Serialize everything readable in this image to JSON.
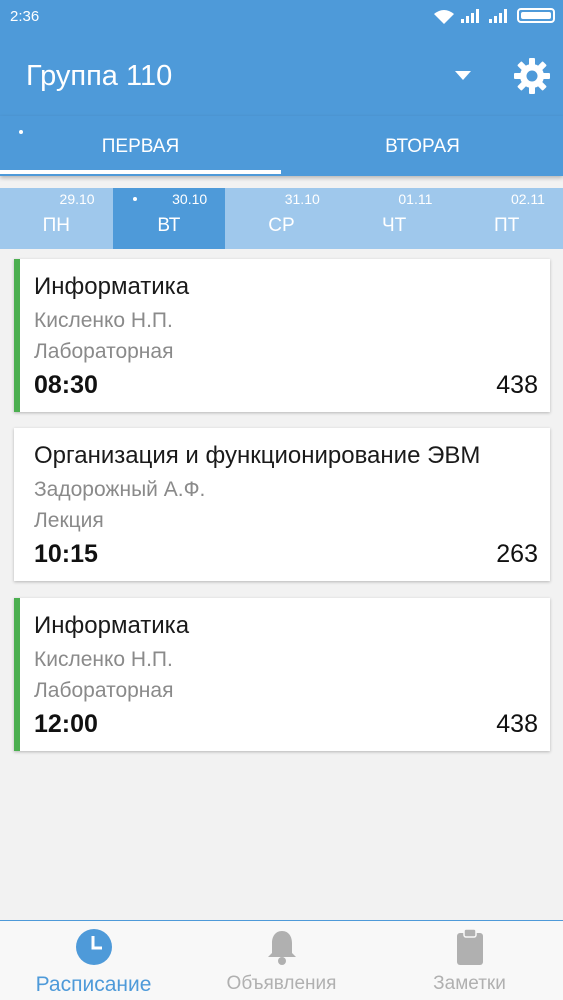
{
  "status_bar": {
    "time": "2:36"
  },
  "app_bar": {
    "title": "Группа 110",
    "icons": [
      "dropdown-icon",
      "gear-icon"
    ]
  },
  "tabs": [
    {
      "label": "ПЕРВАЯ",
      "selected": true
    },
    {
      "label": "ВТОРАЯ",
      "selected": false
    }
  ],
  "days": [
    {
      "date": "29.10",
      "name": "ПН",
      "selected": false
    },
    {
      "date": "30.10",
      "name": "ВТ",
      "selected": true
    },
    {
      "date": "31.10",
      "name": "СР",
      "selected": false
    },
    {
      "date": "01.11",
      "name": "ЧТ",
      "selected": false
    },
    {
      "date": "02.11",
      "name": "ПТ",
      "selected": false
    }
  ],
  "lessons": [
    {
      "subject": "Информатика",
      "teacher": "Кисленко Н.П.",
      "type": "Лабораторная",
      "time": "08:30",
      "room": "438",
      "accent_color": "#4caf50"
    },
    {
      "subject": "Организация и функционирование ЭВМ",
      "teacher": "Задорожный А.Ф.",
      "type": "Лекция",
      "time": "10:15",
      "room": "263",
      "accent_color": ""
    },
    {
      "subject": "Информатика",
      "teacher": "Кисленко Н.П.",
      "type": "Лабораторная",
      "time": "12:00",
      "room": "438",
      "accent_color": "#4caf50"
    }
  ],
  "bottom_nav": [
    {
      "label": "Расписание",
      "icon": "clock-icon",
      "selected": true
    },
    {
      "label": "Объявления",
      "icon": "bell-icon",
      "selected": false
    },
    {
      "label": "Заметки",
      "icon": "clipboard-icon",
      "selected": false
    }
  ],
  "colors": {
    "primary": "#4e9ad9",
    "days_bar": "#9fc8ec",
    "lab_accent": "#4caf50",
    "inactive": "#b0b0b0"
  }
}
